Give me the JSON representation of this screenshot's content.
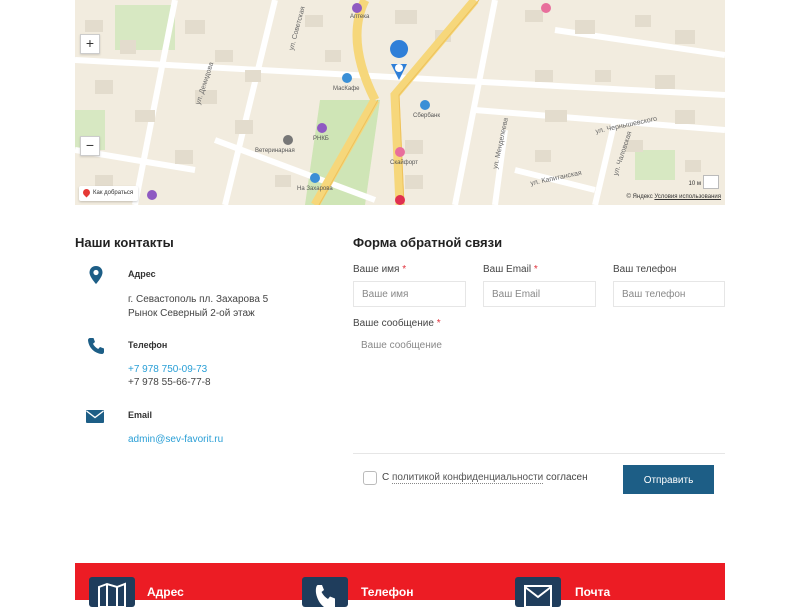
{
  "map": {
    "streets": [
      "ул. Демидова",
      "ул. Советская",
      "ул. Менделеева",
      "ул. Чернышевского",
      "ул. Капитанская",
      "ул. Чаловская"
    ],
    "pois": [
      "Аптека",
      "МасКафе",
      "РНКБ",
      "Ветеринарная",
      "Сбербанк",
      "Скайфорт",
      "На Захарова"
    ],
    "zoom_in": "+",
    "zoom_out": "−",
    "route_label": "Как добраться",
    "scale": "10 м",
    "copyright_brand": "© Яндекс",
    "copyright_link": "Условия использования"
  },
  "contacts": {
    "title": "Наши контакты",
    "address_label": "Адрес",
    "address_line1": "г. Севастополь пл. Захарова 5",
    "address_line2": "Рынок Северный 2-ой этаж",
    "phone_label": "Телефон",
    "phone1": "+7 978 750-09-73",
    "phone2": "+7 978 55-66-77-8",
    "email_label": "Email",
    "email": "admin@sev-favorit.ru"
  },
  "form": {
    "title": "Форма обратной связи",
    "name_label": "Ваше имя",
    "name_placeholder": "Ваше имя",
    "email_label": "Ваш Email",
    "email_placeholder": "Ваш Email",
    "phone_label": "Ваш телефон",
    "phone_placeholder": "Ваш телефон",
    "message_label": "Ваше сообщение",
    "message_placeholder": "Ваше сообщение",
    "required_mark": "*",
    "agree_prefix": "С",
    "agree_policy": "политикой конфиденциальности",
    "agree_suffix": "согласен",
    "submit_label": "Отправить"
  },
  "footer": {
    "address_heading": "Адрес",
    "phone_heading": "Телефон",
    "mail_heading": "Почта"
  },
  "colors": {
    "footer_bg": "#ec1c24",
    "button_bg": "#1d5e86",
    "icon_color": "#1d5e86",
    "link_color": "#2a9fd6"
  }
}
